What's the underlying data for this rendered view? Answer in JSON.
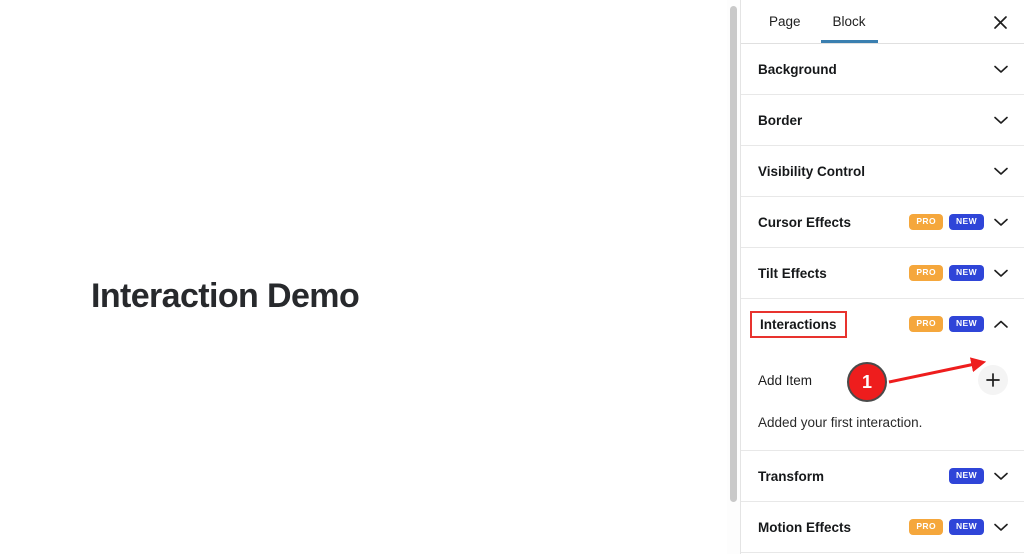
{
  "canvas": {
    "heading": "Interaction Demo"
  },
  "inspector": {
    "tabs": [
      {
        "label": "Page",
        "active": false
      },
      {
        "label": "Block",
        "active": true
      }
    ],
    "close_icon": "close-icon",
    "accent_active_tab": "#3a7fb0",
    "sections": [
      {
        "title": "Background",
        "badges": [],
        "expanded": false,
        "highlighted": false
      },
      {
        "title": "Border",
        "badges": [],
        "expanded": false,
        "highlighted": false
      },
      {
        "title": "Visibility Control",
        "badges": [],
        "expanded": false,
        "highlighted": false
      },
      {
        "title": "Cursor Effects",
        "badges": [
          "PRO",
          "NEW"
        ],
        "expanded": false,
        "highlighted": false
      },
      {
        "title": "Tilt Effects",
        "badges": [
          "PRO",
          "NEW"
        ],
        "expanded": false,
        "highlighted": false
      },
      {
        "title": "Interactions",
        "badges": [
          "PRO",
          "NEW"
        ],
        "expanded": true,
        "highlighted": true
      },
      {
        "title": "Transform",
        "badges": [
          "NEW"
        ],
        "expanded": false,
        "highlighted": false
      },
      {
        "title": "Motion Effects",
        "badges": [
          "PRO",
          "NEW"
        ],
        "expanded": false,
        "highlighted": false
      }
    ],
    "interactions_body": {
      "add_item_label": "Add Item",
      "add_button_icon": "plus-icon",
      "helper_text": "Added your first interaction."
    }
  },
  "annotations": {
    "step_number": "1",
    "highlight_color": "#e8332e",
    "arrow_color": "#ee1d1d",
    "badge_color": "#ee1d1d"
  },
  "colors": {
    "badge_pro": "#f5a73c",
    "badge_new": "#2f45d8",
    "panel_background": "#ffffff",
    "canvas_background": "#ffffff"
  }
}
